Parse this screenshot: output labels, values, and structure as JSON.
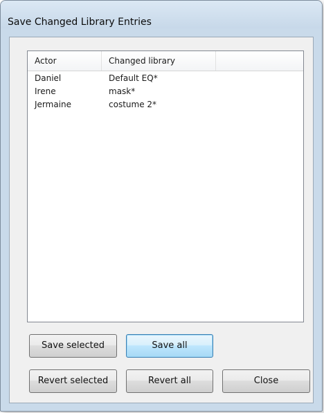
{
  "window": {
    "title": "Save Changed Library Entries"
  },
  "list": {
    "columns": [
      "Actor",
      "Changed library",
      ""
    ],
    "rows": [
      {
        "actor": "Daniel",
        "library": "Default EQ*"
      },
      {
        "actor": "Irene",
        "library": "mask*"
      },
      {
        "actor": "Jermaine",
        "library": "costume 2*"
      }
    ]
  },
  "buttons": {
    "save_selected": "Save selected",
    "save_all": "Save all",
    "revert_selected": "Revert selected",
    "revert_all": "Revert all",
    "close": "Close"
  },
  "colors": {
    "window_frame": "#c9daea",
    "default_button": "#bee6fd"
  }
}
